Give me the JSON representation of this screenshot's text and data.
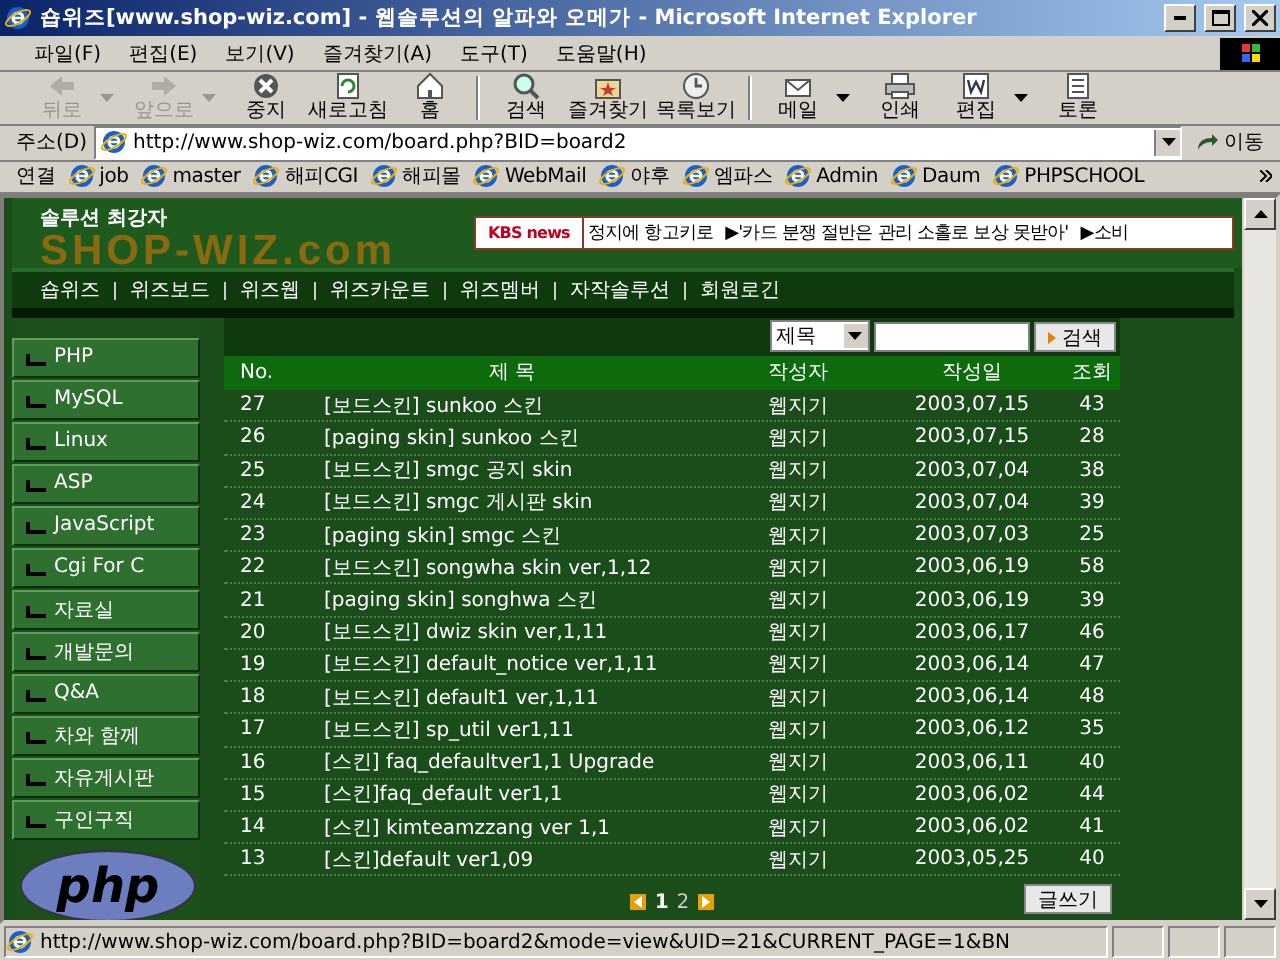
{
  "window": {
    "title": "숍위즈[www.shop-wiz.com] - 웹솔루션의 알파와 오메가 - Microsoft Internet Explorer"
  },
  "menu": [
    "파일(F)",
    "편집(E)",
    "보기(V)",
    "즐겨찾기(A)",
    "도구(T)",
    "도움말(H)"
  ],
  "toolbar": [
    {
      "label": "뒤로",
      "disabled": true,
      "dropdown": true
    },
    {
      "label": "앞으로",
      "disabled": true,
      "dropdown": true
    },
    {
      "label": "중지",
      "disabled": false,
      "dropdown": false
    },
    {
      "label": "새로고침",
      "disabled": false,
      "dropdown": false
    },
    {
      "label": "홈",
      "disabled": false,
      "dropdown": false
    },
    {
      "label": "검색",
      "disabled": false,
      "dropdown": false
    },
    {
      "label": "즐겨찾기",
      "disabled": false,
      "dropdown": false
    },
    {
      "label": "목록보기",
      "disabled": false,
      "dropdown": false
    },
    {
      "label": "메일",
      "disabled": false,
      "dropdown": true
    },
    {
      "label": "인쇄",
      "disabled": false,
      "dropdown": false
    },
    {
      "label": "편집",
      "disabled": false,
      "dropdown": true
    },
    {
      "label": "토론",
      "disabled": false,
      "dropdown": false
    }
  ],
  "address": {
    "label": "주소(D)",
    "value": "http://www.shop-wiz.com/board.php?BID=board2",
    "go": "이동"
  },
  "links": {
    "label": "연결",
    "items": [
      "job",
      "master",
      "해피CGI",
      "해피몰",
      "WebMail",
      "야후",
      "엠파스",
      "Admin",
      "Daum",
      "PHPSCHOOL"
    ]
  },
  "site": {
    "tagline": "솔루션 최강자",
    "logo": "SHOP-WIZ.com",
    "news_label": "KBS news",
    "news": [
      "정지에 항고키로",
      "▶'카드 분쟁 절반은 관리 소홀로 보상 못받아'",
      "▶소비"
    ],
    "nav": [
      "숍위즈",
      "위즈보드",
      "위즈웹",
      "위즈카운트",
      "위즈멤버",
      "자작솔루션",
      "회원로긴"
    ],
    "sidebar": [
      "PHP",
      "MySQL",
      "Linux",
      "ASP",
      "JavaScript",
      "Cgi For C",
      "자료실",
      "개발문의",
      "Q&A",
      "차와 함께",
      "자유게시판",
      "구인구직"
    ],
    "php_logo": "php"
  },
  "board": {
    "search_field": "제목",
    "search_button": "검색",
    "columns": [
      "No.",
      "제 목",
      "작성자",
      "작성일",
      "조회"
    ],
    "rows": [
      [
        "27",
        "[보드스킨] sunkoo 스킨",
        "웹지기",
        "2003,07,15",
        "43"
      ],
      [
        "26",
        "[paging skin] sunkoo 스킨",
        "웹지기",
        "2003,07,15",
        "28"
      ],
      [
        "25",
        "[보드스킨] smgc 공지 skin",
        "웹지기",
        "2003,07,04",
        "38"
      ],
      [
        "24",
        "[보드스킨] smgc 게시판 skin",
        "웹지기",
        "2003,07,04",
        "39"
      ],
      [
        "23",
        "[paging skin] smgc 스킨",
        "웹지기",
        "2003,07,03",
        "25"
      ],
      [
        "22",
        "[보드스킨] songwha skin ver,1,12",
        "웹지기",
        "2003,06,19",
        "58"
      ],
      [
        "21",
        "[paging skin] songhwa 스킨",
        "웹지기",
        "2003,06,19",
        "39"
      ],
      [
        "20",
        "[보드스킨] dwiz skin ver,1,11",
        "웹지기",
        "2003,06,17",
        "46"
      ],
      [
        "19",
        "[보드스킨] default_notice ver,1,11",
        "웹지기",
        "2003,06,14",
        "47"
      ],
      [
        "18",
        "[보드스킨] default1 ver,1,11",
        "웹지기",
        "2003,06,14",
        "48"
      ],
      [
        "17",
        "[보드스킨] sp_util ver1,11",
        "웹지기",
        "2003,06,12",
        "35"
      ],
      [
        "16",
        "[스킨] faq_defaultver1,1 Upgrade",
        "웹지기",
        "2003,06,11",
        "40"
      ],
      [
        "15",
        "[스킨]faq_default ver1,1",
        "웹지기",
        "2003,06,02",
        "44"
      ],
      [
        "14",
        "[스킨] kimteamzzang ver 1,1",
        "웹지기",
        "2003,06,02",
        "41"
      ],
      [
        "13",
        "[스킨]default ver1,09",
        "웹지기",
        "2003,05,25",
        "40"
      ]
    ],
    "pages": [
      {
        "label": "1",
        "selected": true
      },
      {
        "label": "2",
        "selected": false
      }
    ],
    "write_button": "글쓰기"
  },
  "status_bar": {
    "text": "http://www.shop-wiz.com/board.php?BID=board2&mode=view&UID=21&CURRENT_PAGE=1&BN"
  }
}
